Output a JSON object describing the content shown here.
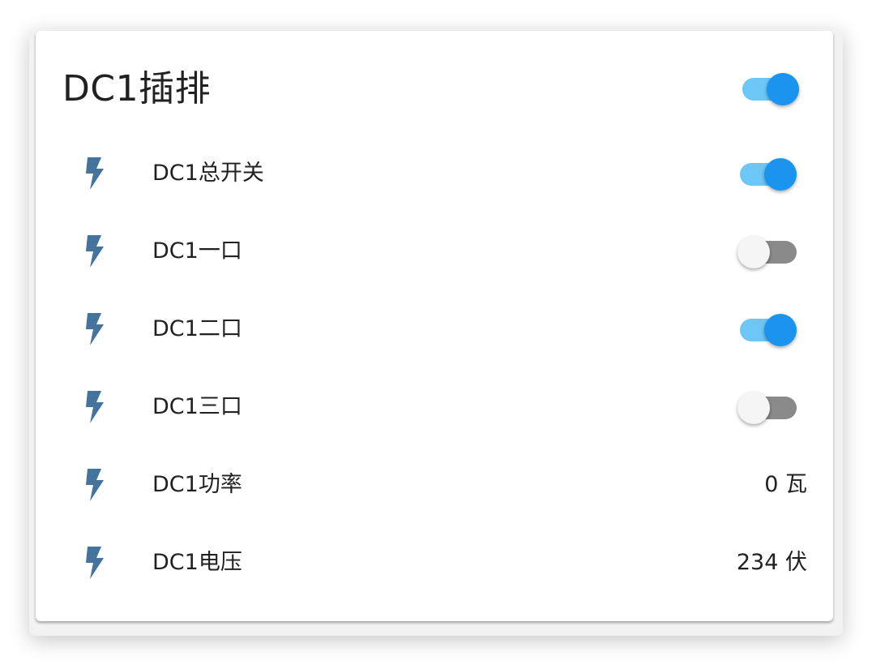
{
  "card": {
    "title": "DC1插排",
    "master_toggle_on": true
  },
  "rows": [
    {
      "label": "DC1总开关",
      "icon": "flash-icon",
      "type": "toggle",
      "on": true
    },
    {
      "label": "DC1一口",
      "icon": "flash-icon",
      "type": "toggle",
      "on": false
    },
    {
      "label": "DC1二口",
      "icon": "flash-icon",
      "type": "toggle",
      "on": true
    },
    {
      "label": "DC1三口",
      "icon": "flash-icon",
      "type": "toggle",
      "on": false
    },
    {
      "label": "DC1功率",
      "icon": "flash-icon",
      "type": "sensor",
      "value": "0 瓦"
    },
    {
      "label": "DC1电压",
      "icon": "flash-icon",
      "type": "sensor",
      "value": "234 伏"
    }
  ],
  "colors": {
    "icon": "#44739e",
    "toggle_on_track": "#6cc6f6",
    "toggle_on_thumb": "#1a94ef",
    "toggle_off_track": "#8a8a8a",
    "toggle_off_thumb": "#f5f5f5"
  }
}
